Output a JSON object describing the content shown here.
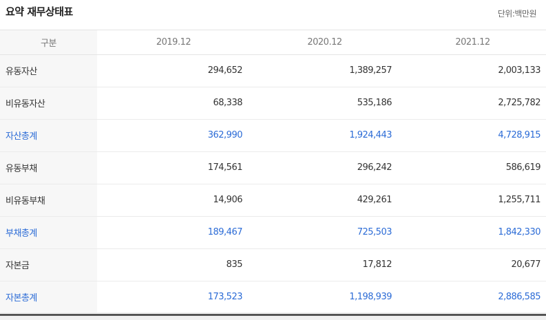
{
  "header": {
    "title": "요약 재무상태표",
    "unit": "단위:백만원"
  },
  "table": {
    "columns": [
      "구분",
      "2019.12",
      "2020.12",
      "2021.12"
    ],
    "rows": [
      {
        "label": "유동자산",
        "values": [
          "294,652",
          "1,389,257",
          "2,003,133"
        ],
        "total": false
      },
      {
        "label": "비유동자산",
        "values": [
          "68,338",
          "535,186",
          "2,725,782"
        ],
        "total": false
      },
      {
        "label": "자산총계",
        "values": [
          "362,990",
          "1,924,443",
          "4,728,915"
        ],
        "total": true
      },
      {
        "label": "유동부채",
        "values": [
          "174,561",
          "296,242",
          "586,619"
        ],
        "total": false
      },
      {
        "label": "비유동부채",
        "values": [
          "14,906",
          "429,261",
          "1,255,711"
        ],
        "total": false
      },
      {
        "label": "부채총계",
        "values": [
          "189,467",
          "725,503",
          "1,842,330"
        ],
        "total": true
      },
      {
        "label": "자본금",
        "values": [
          "835",
          "17,812",
          "20,677"
        ],
        "total": false
      },
      {
        "label": "자본총계",
        "values": [
          "173,523",
          "1,198,939",
          "2,886,585"
        ],
        "total": true
      }
    ]
  },
  "colors": {
    "total_text": "#2b6bd6",
    "label_bg": "#f7f7f7"
  }
}
